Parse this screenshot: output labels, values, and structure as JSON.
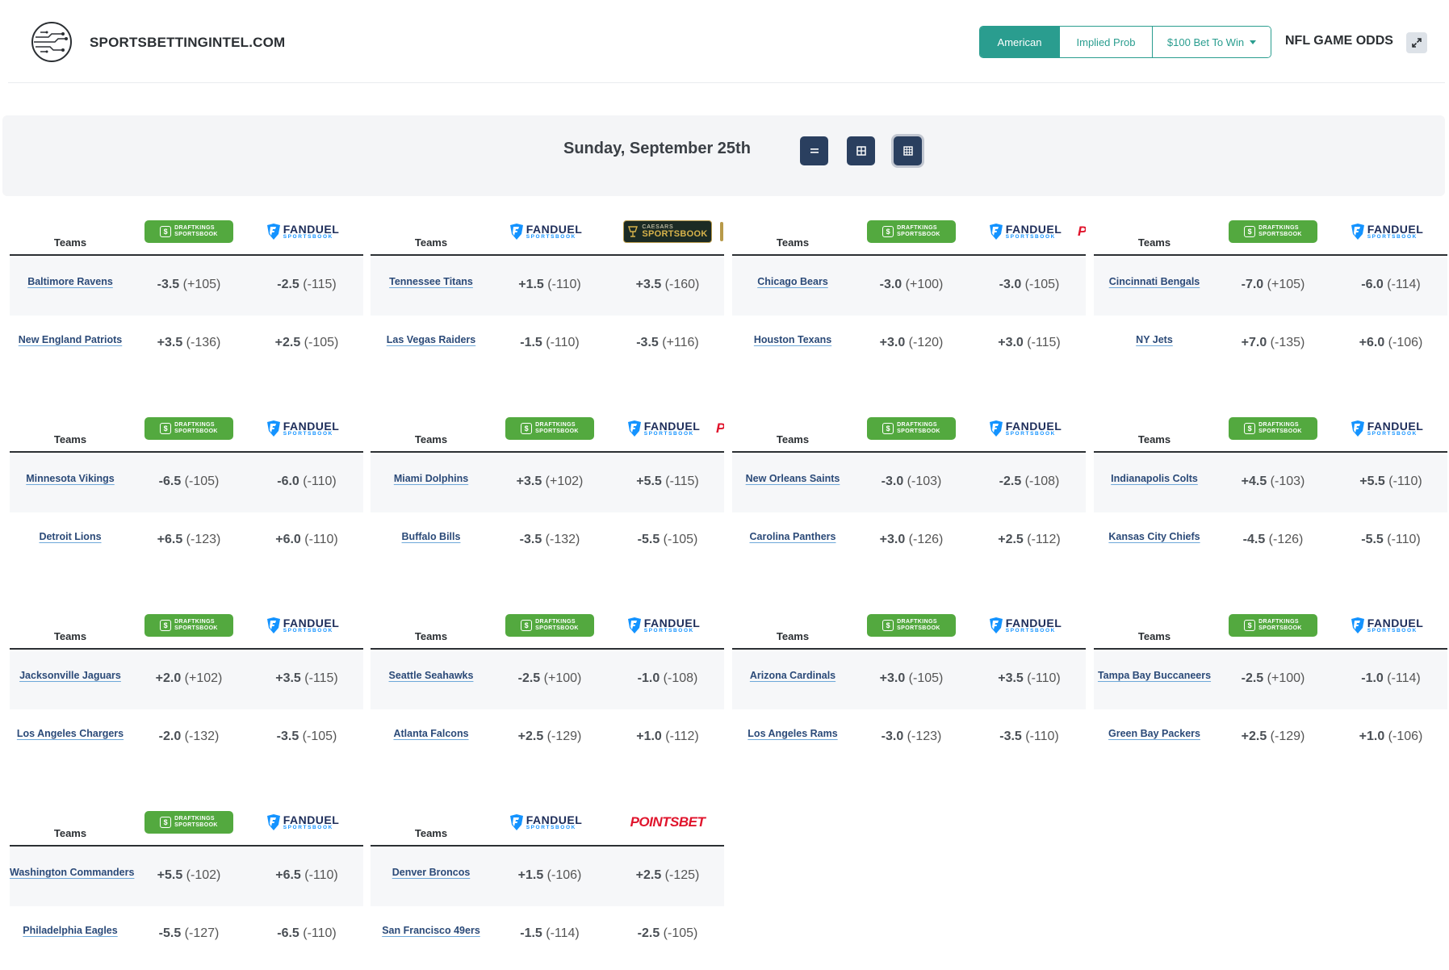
{
  "header": {
    "site_name": "SPORTSBETTINGINTEL.COM",
    "odds_formats": [
      {
        "label": "American",
        "active": true
      },
      {
        "label": "Implied Prob",
        "active": false
      },
      {
        "label": "$100 Bet To Win",
        "active": false,
        "dropdown": true
      }
    ],
    "page_title": "NFL GAME ODDS",
    "expand_icon": "expand-icon"
  },
  "datebar": {
    "date": "Sunday, September 25th",
    "view_buttons": [
      "list-view-icon",
      "grid-view-icon",
      "table-view-icon"
    ],
    "active_view": 2
  },
  "sportsbook_labels": {
    "dk_line1": "DRAFTKINGS",
    "dk_line2": "SPORTSBOOK",
    "fd_main": "FANDUEL",
    "fd_sub": "SPORTSBOOK",
    "cz_top": "CAESARS",
    "cz_main": "SPORTSBOOK",
    "pb": "POINTSBET",
    "pb_peek": "P"
  },
  "games_header_label": "Teams",
  "games": [
    {
      "books": [
        "dk",
        "fd"
      ],
      "teams": [
        {
          "name": "Baltimore Ravens",
          "odds": [
            {
              "line": "-3.5",
              "price": "(+105)"
            },
            {
              "line": "-2.5",
              "price": "(-115)"
            }
          ]
        },
        {
          "name": "New England Patriots",
          "odds": [
            {
              "line": "+3.5",
              "price": "(-136)"
            },
            {
              "line": "+2.5",
              "price": "(-105)"
            }
          ]
        }
      ]
    },
    {
      "books": [
        "fd",
        "cz"
      ],
      "peek": "bar",
      "teams": [
        {
          "name": "Tennessee Titans",
          "odds": [
            {
              "line": "+1.5",
              "price": "(-110)"
            },
            {
              "line": "+3.5",
              "price": "(-160)"
            }
          ]
        },
        {
          "name": "Las Vegas Raiders",
          "odds": [
            {
              "line": "-1.5",
              "price": "(-110)"
            },
            {
              "line": "-3.5",
              "price": "(+116)"
            }
          ]
        }
      ]
    },
    {
      "books": [
        "dk",
        "fd"
      ],
      "peek": "p",
      "teams": [
        {
          "name": "Chicago Bears",
          "odds": [
            {
              "line": "-3.0",
              "price": "(+100)"
            },
            {
              "line": "-3.0",
              "price": "(-105)"
            }
          ]
        },
        {
          "name": "Houston Texans",
          "odds": [
            {
              "line": "+3.0",
              "price": "(-120)"
            },
            {
              "line": "+3.0",
              "price": "(-115)"
            }
          ]
        }
      ]
    },
    {
      "books": [
        "dk",
        "fd"
      ],
      "teams": [
        {
          "name": "Cincinnati Bengals",
          "odds": [
            {
              "line": "-7.0",
              "price": "(+105)"
            },
            {
              "line": "-6.0",
              "price": "(-114)"
            }
          ]
        },
        {
          "name": "NY Jets",
          "odds": [
            {
              "line": "+7.0",
              "price": "(-135)"
            },
            {
              "line": "+6.0",
              "price": "(-106)"
            }
          ]
        }
      ]
    },
    {
      "books": [
        "dk",
        "fd"
      ],
      "teams": [
        {
          "name": "Minnesota Vikings",
          "odds": [
            {
              "line": "-6.5",
              "price": "(-105)"
            },
            {
              "line": "-6.0",
              "price": "(-110)"
            }
          ]
        },
        {
          "name": "Detroit Lions",
          "odds": [
            {
              "line": "+6.5",
              "price": "(-123)"
            },
            {
              "line": "+6.0",
              "price": "(-110)"
            }
          ]
        }
      ]
    },
    {
      "books": [
        "dk",
        "fd"
      ],
      "peek": "p",
      "teams": [
        {
          "name": "Miami Dolphins",
          "odds": [
            {
              "line": "+3.5",
              "price": "(+102)"
            },
            {
              "line": "+5.5",
              "price": "(-115)"
            }
          ]
        },
        {
          "name": "Buffalo Bills",
          "odds": [
            {
              "line": "-3.5",
              "price": "(-132)"
            },
            {
              "line": "-5.5",
              "price": "(-105)"
            }
          ]
        }
      ]
    },
    {
      "books": [
        "dk",
        "fd"
      ],
      "teams": [
        {
          "name": "New Orleans Saints",
          "odds": [
            {
              "line": "-3.0",
              "price": "(-103)"
            },
            {
              "line": "-2.5",
              "price": "(-108)"
            }
          ]
        },
        {
          "name": "Carolina Panthers",
          "odds": [
            {
              "line": "+3.0",
              "price": "(-126)"
            },
            {
              "line": "+2.5",
              "price": "(-112)"
            }
          ]
        }
      ]
    },
    {
      "books": [
        "dk",
        "fd"
      ],
      "teams": [
        {
          "name": "Indianapolis Colts",
          "odds": [
            {
              "line": "+4.5",
              "price": "(-103)"
            },
            {
              "line": "+5.5",
              "price": "(-110)"
            }
          ]
        },
        {
          "name": "Kansas City Chiefs",
          "odds": [
            {
              "line": "-4.5",
              "price": "(-126)"
            },
            {
              "line": "-5.5",
              "price": "(-110)"
            }
          ]
        }
      ]
    },
    {
      "books": [
        "dk",
        "fd"
      ],
      "teams": [
        {
          "name": "Jacksonville Jaguars",
          "odds": [
            {
              "line": "+2.0",
              "price": "(+102)"
            },
            {
              "line": "+3.5",
              "price": "(-115)"
            }
          ]
        },
        {
          "name": "Los Angeles Chargers",
          "odds": [
            {
              "line": "-2.0",
              "price": "(-132)"
            },
            {
              "line": "-3.5",
              "price": "(-105)"
            }
          ]
        }
      ]
    },
    {
      "books": [
        "dk",
        "fd"
      ],
      "teams": [
        {
          "name": "Seattle Seahawks",
          "odds": [
            {
              "line": "-2.5",
              "price": "(+100)"
            },
            {
              "line": "-1.0",
              "price": "(-108)"
            }
          ]
        },
        {
          "name": "Atlanta Falcons",
          "odds": [
            {
              "line": "+2.5",
              "price": "(-129)"
            },
            {
              "line": "+1.0",
              "price": "(-112)"
            }
          ]
        }
      ]
    },
    {
      "books": [
        "dk",
        "fd"
      ],
      "teams": [
        {
          "name": "Arizona Cardinals",
          "odds": [
            {
              "line": "+3.0",
              "price": "(-105)"
            },
            {
              "line": "+3.5",
              "price": "(-110)"
            }
          ]
        },
        {
          "name": "Los Angeles Rams",
          "odds": [
            {
              "line": "-3.0",
              "price": "(-123)"
            },
            {
              "line": "-3.5",
              "price": "(-110)"
            }
          ]
        }
      ]
    },
    {
      "books": [
        "dk",
        "fd"
      ],
      "teams": [
        {
          "name": "Tampa Bay Buccaneers",
          "odds": [
            {
              "line": "-2.5",
              "price": "(+100)"
            },
            {
              "line": "-1.0",
              "price": "(-114)"
            }
          ]
        },
        {
          "name": "Green Bay Packers",
          "odds": [
            {
              "line": "+2.5",
              "price": "(-129)"
            },
            {
              "line": "+1.0",
              "price": "(-106)"
            }
          ]
        }
      ]
    },
    {
      "books": [
        "dk",
        "fd"
      ],
      "teams": [
        {
          "name": "Washington Commanders",
          "odds": [
            {
              "line": "+5.5",
              "price": "(-102)"
            },
            {
              "line": "+6.5",
              "price": "(-110)"
            }
          ]
        },
        {
          "name": "Philadelphia Eagles",
          "odds": [
            {
              "line": "-5.5",
              "price": "(-127)"
            },
            {
              "line": "-6.5",
              "price": "(-110)"
            }
          ]
        }
      ]
    },
    {
      "books": [
        "fd",
        "pb"
      ],
      "teams": [
        {
          "name": "Denver Broncos",
          "odds": [
            {
              "line": "+1.5",
              "price": "(-106)"
            },
            {
              "line": "+2.5",
              "price": "(-125)"
            }
          ]
        },
        {
          "name": "San Francisco 49ers",
          "odds": [
            {
              "line": "-1.5",
              "price": "(-114)"
            },
            {
              "line": "-2.5",
              "price": "(-105)"
            }
          ]
        }
      ]
    }
  ],
  "colors": {
    "accent": "#2a9d8f",
    "view_button": "#2a3f5f",
    "draftkings_green": "#53a93f",
    "fanduel_navy": "#1d2d5a",
    "fanduel_blue": "#1493ff",
    "pointsbet_red": "#e0142c",
    "caesars_gold": "#d7b34b",
    "team_link": "#2b4a78"
  }
}
